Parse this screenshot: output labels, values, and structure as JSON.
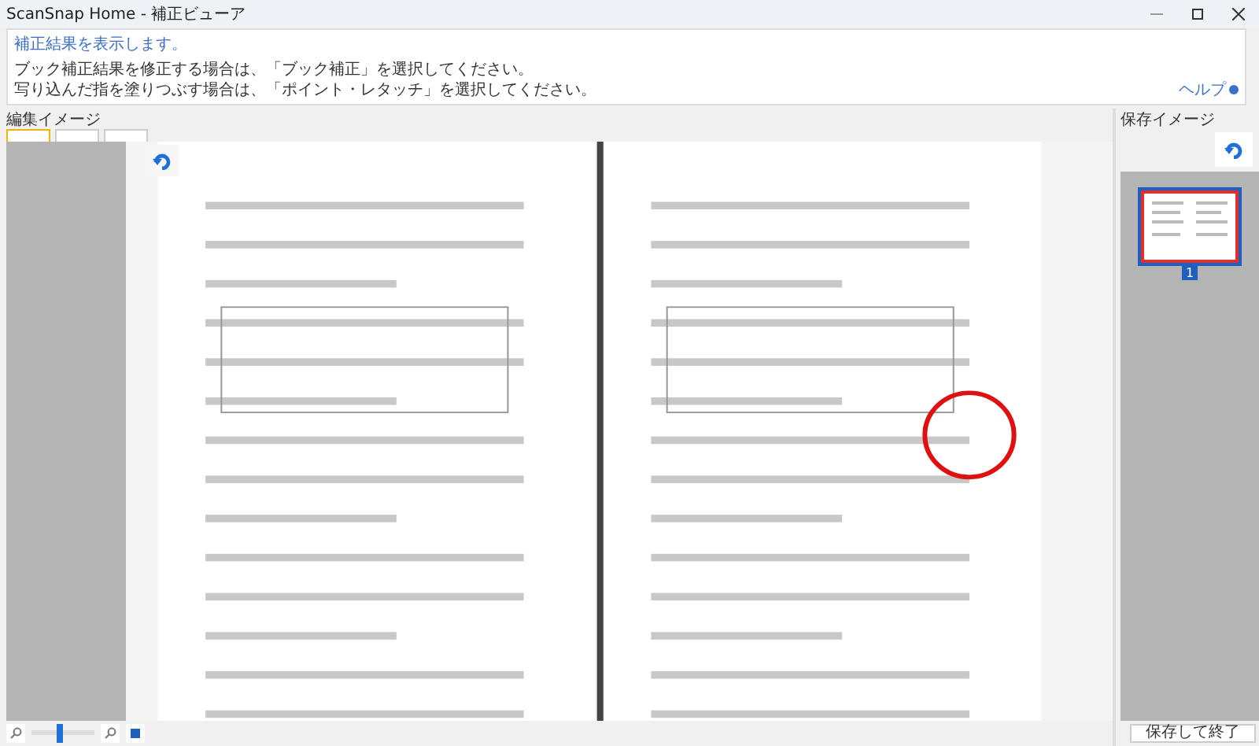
{
  "window": {
    "title": "ScanSnap Home - 補正ビューア"
  },
  "message": {
    "status": "補正結果を表示します。",
    "lines": [
      "ブック補正結果を修正する場合は、「ブック補正」を選択してください。",
      "写り込んだ指を塗りつぶす場合は、「ポイント・レタッチ」を選択してください。"
    ],
    "help": "ヘルプ"
  },
  "edit_panel": {
    "label": "編集イメージ",
    "tools": [
      {
        "selected": true
      },
      {
        "selected": false
      },
      {
        "selected": false
      }
    ],
    "zoom": {
      "level": 0.45
    }
  },
  "save_panel": {
    "label": "保存イメージ",
    "thumbnails": [
      {
        "number": "1",
        "selected": true
      }
    ],
    "save_button": "保存して終了"
  }
}
